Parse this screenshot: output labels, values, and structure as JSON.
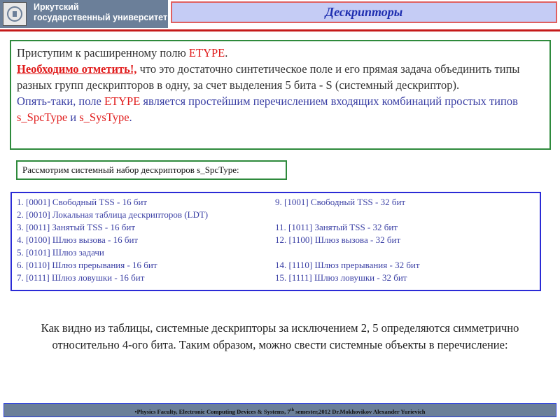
{
  "header": {
    "logo_line1": "Иркутский",
    "logo_line2": "государственный университет",
    "title": "Дескрипторы"
  },
  "intro": {
    "line1_text": "Приступим к расширенному полю ",
    "line1_etype": "ETYPE",
    "line1_end": ".",
    "note_label": "Необходимо отметить!,",
    "note_text": " что это достаточно синтетическое поле и его прямая задача объединить типы разных групп дескрипторов в одну, за счет выделения 5 бита - S (системный дескриптор).",
    "bullet": "",
    "p2_start": "Опять-таки, поле ",
    "p2_etype": "ETYPE",
    "p2_mid": " является простейшим перечислением входящих комбинаций простых типов ",
    "p2_type1": "s_SpcType",
    "p2_and": " и ",
    "p2_type2": "s_SysType",
    "p2_end": "."
  },
  "subheading": "Рассмотрим системный набор дескрипторов s_SpcType:",
  "descriptor_rows": [
    {
      "left": "1. [0001] Свободный TSS - 16 бит",
      "right": "9. [1001] Свободный TSS - 32 бит"
    },
    {
      "left": "2. [0010] Локальная таблица дескрипторов (LDT)",
      "right": ""
    },
    {
      "left": "3. [0011] Занятый TSS - 16 бит",
      "right": "11. [1011] Занятый TSS - 32 бит"
    },
    {
      "left": "4. [0100] Шлюз вызова - 16 бит",
      "right": "12. [1100] Шлюз вызова - 32 бит"
    },
    {
      "left": "5. [0101] Шлюз задачи",
      "right": ""
    },
    {
      "left": "6. [0110] Шлюз прерывания - 16 бит",
      "right": "14. [1110] Шлюз прерывания - 32 бит"
    },
    {
      "left": "7. [0111] Шлюз ловушки - 16 бит",
      "right": "15. [1111] Шлюз ловушки - 32 бит"
    }
  ],
  "summary": "Как видно из таблицы, системные дескрипторы за исключением 2, 5 определяются симметрично относительно 4-ого бита. Таким образом, можно свести системные объекты в перечисление:",
  "footer": {
    "text_before": "•Physics Faculty, Electronic Computing Devices & Systems, 7",
    "sup": "th",
    "text_after": " semester,2012 Dr.Mokhovikov Alexander Yurievich"
  },
  "colors": {
    "header_bg": "#6b7f99",
    "title_bg": "#c5ccf5",
    "accent_red": "#e01b1b",
    "text_blue": "#3a3fa4",
    "green_border": "#2e8a3c",
    "blue_border": "#2b2bd6"
  }
}
